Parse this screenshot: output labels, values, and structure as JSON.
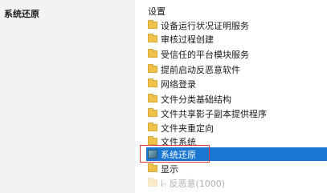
{
  "left_pane": {
    "title": "系统还原"
  },
  "right_pane": {
    "header": "设置",
    "items": [
      {
        "label": "设备运行状况证明服务",
        "icon": "folder-icon"
      },
      {
        "label": "审核过程创建",
        "icon": "folder-icon"
      },
      {
        "label": "受信任的平台模块服务",
        "icon": "folder-icon"
      },
      {
        "label": "提前启动反恶意软件",
        "icon": "folder-icon"
      },
      {
        "label": "网络登录",
        "icon": "folder-icon"
      },
      {
        "label": "文件分类基础结构",
        "icon": "folder-icon"
      },
      {
        "label": "文件共享影子副本提供程序",
        "icon": "folder-icon"
      },
      {
        "label": "文件夹重定向",
        "icon": "folder-icon"
      },
      {
        "label": "文件系统",
        "icon": "folder-icon"
      },
      {
        "label": "系统还原",
        "icon": "system-restore-icon",
        "selected": true
      },
      {
        "label": "显示",
        "icon": "folder-icon"
      }
    ],
    "partial_item": {
      "label": "i- 反恶意(1000)"
    }
  },
  "colors": {
    "selected_bg": "#1976d2",
    "highlight_border": "#e03b3b",
    "folder": "#f0c24a"
  }
}
